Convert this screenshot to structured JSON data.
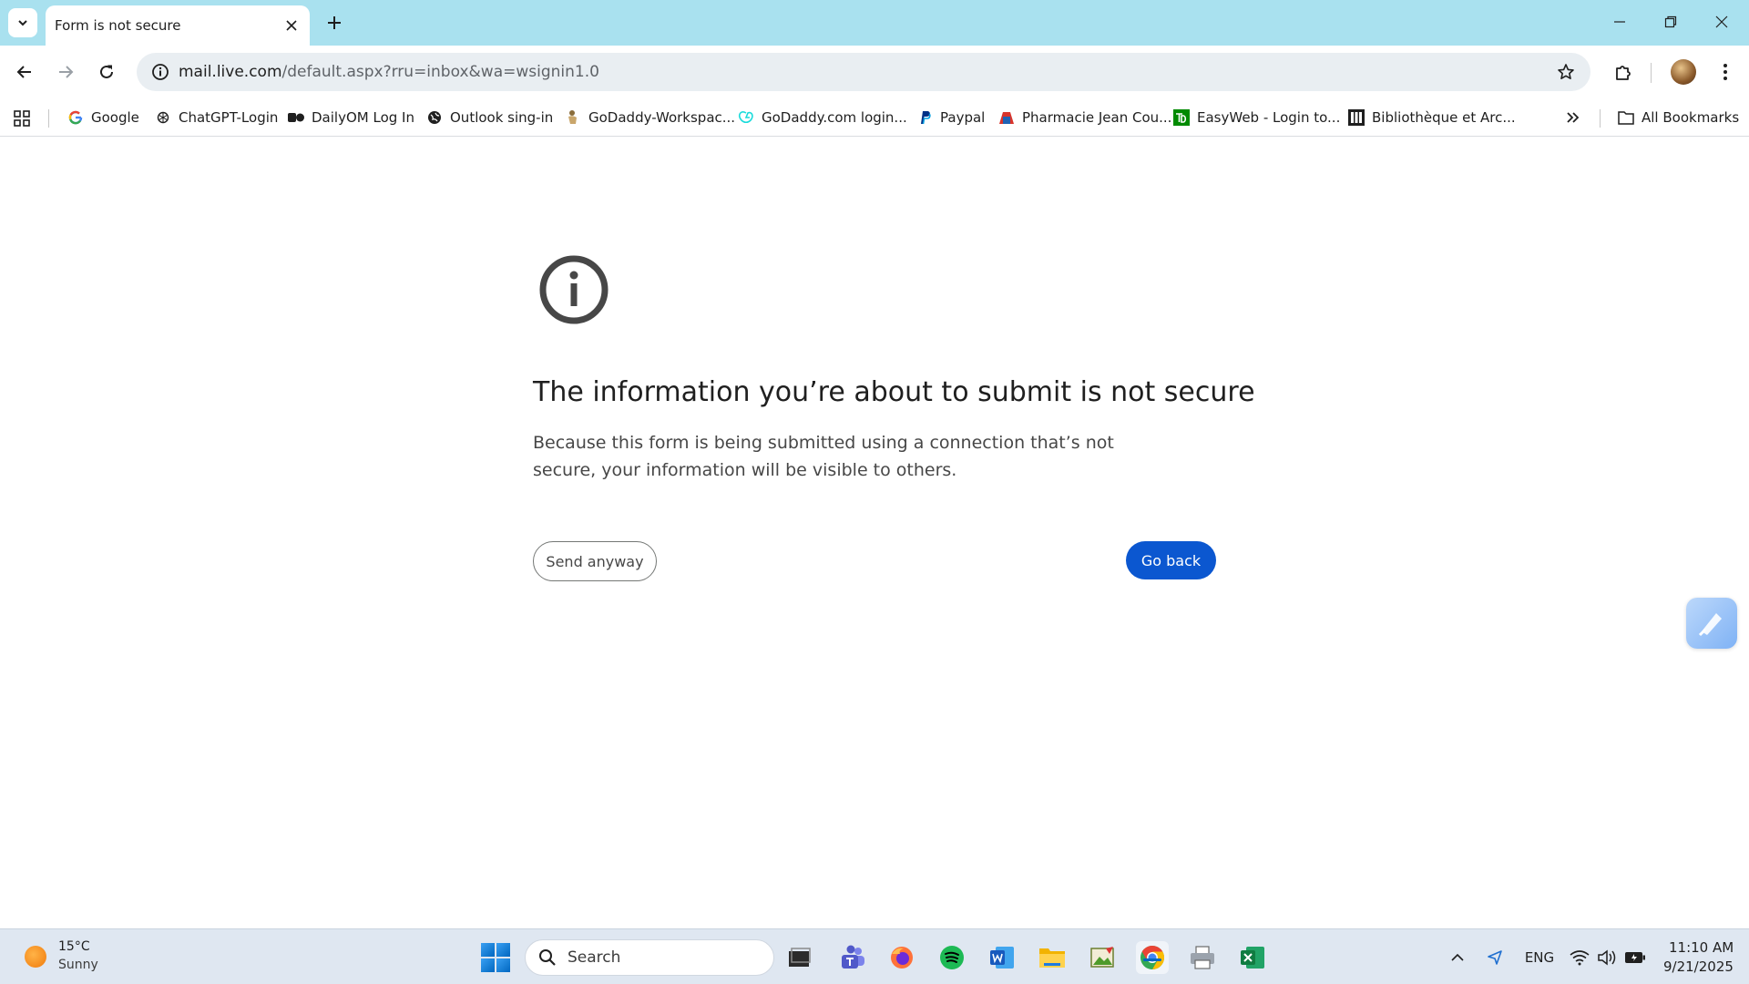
{
  "tab": {
    "title": "Form is not secure"
  },
  "omnibox": {
    "url_host": "mail.live.com",
    "url_rest": "/default.aspx?rru=inbox&wa=wsignin1.0"
  },
  "bookmarks": {
    "items": [
      {
        "label": "Google",
        "icon": "google-icon"
      },
      {
        "label": "ChatGPT-Login",
        "icon": "openai-icon"
      },
      {
        "label": "DailyOM Log In",
        "icon": "dailyom-icon"
      },
      {
        "label": "Outlook sing-in",
        "icon": "globe-icon"
      },
      {
        "label": "GoDaddy-Workspac...",
        "icon": "godaddy-icon"
      },
      {
        "label": "GoDaddy.com login...",
        "icon": "godaddy-icon"
      },
      {
        "label": "Paypal",
        "icon": "paypal-icon"
      },
      {
        "label": "Pharmacie Jean Cou...",
        "icon": "pharmacy-icon"
      },
      {
        "label": "EasyWeb - Login to...",
        "icon": "td-icon"
      },
      {
        "label": "Bibliothèque et Arc...",
        "icon": "library-icon"
      }
    ],
    "all_bookmarks_label": "All Bookmarks"
  },
  "page": {
    "heading": "The information you’re about to submit is not secure",
    "description": "Because this form is being submitted using a connection that’s not secure, your information will be visible to others.",
    "send_anyway_label": "Send anyway",
    "go_back_label": "Go back"
  },
  "taskbar": {
    "weather_temp": "15°C",
    "weather_desc": "Sunny",
    "search_label": "Search",
    "language": "ENG",
    "time": "11:10 AM",
    "date": "9/21/2025"
  },
  "colors": {
    "titlebar": "#a9e1ef",
    "primary_button": "#0b57d0",
    "taskbar": "#dfe7f1"
  }
}
